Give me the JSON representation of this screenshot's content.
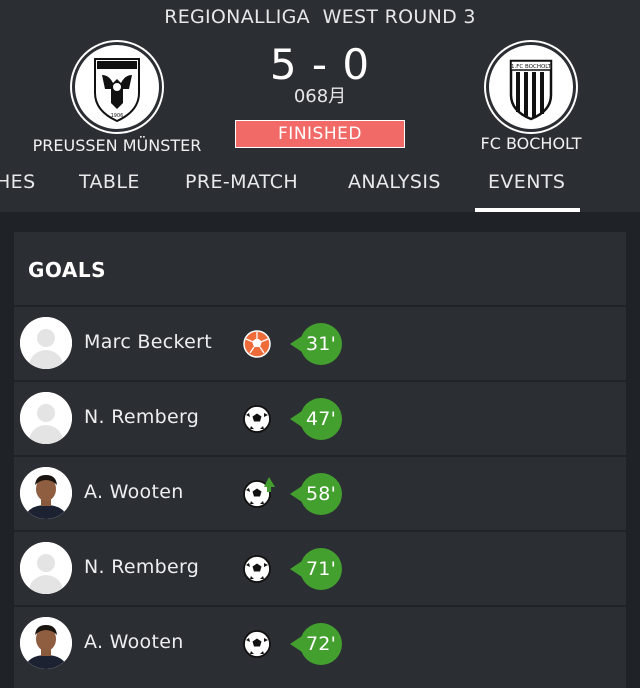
{
  "header": {
    "round_title": "REGIONALLIGA  WEST ROUND 3",
    "score": "5 - 0",
    "date": "068月",
    "status": "FINISHED",
    "home_team": {
      "name": "PREUSSEN MÜNSTER",
      "crest_icon": "preussen-munster-eagle-crest-icon"
    },
    "away_team": {
      "name": "FC BOCHOLT",
      "crest_icon": "fc-bocholt-shield-crest-icon"
    }
  },
  "tabs": [
    {
      "label": "HES",
      "active": false
    },
    {
      "label": "TABLE",
      "active": false
    },
    {
      "label": "PRE-MATCH",
      "active": false
    },
    {
      "label": "ANALYSIS",
      "active": false
    },
    {
      "label": "EVENTS",
      "active": true
    }
  ],
  "goals": {
    "title": "GOALS",
    "items": [
      {
        "player": "Marc Beckert",
        "minute": "31'",
        "goal_type": "own-goal",
        "icon": "own-goal-ball-icon",
        "avatar": "placeholder"
      },
      {
        "player": "N. Remberg",
        "minute": "47'",
        "goal_type": "goal",
        "icon": "soccer-ball-icon",
        "avatar": "placeholder"
      },
      {
        "player": "A. Wooten",
        "minute": "58'",
        "goal_type": "penalty-rebound",
        "icon": "soccer-ball-arrow-icon",
        "avatar": "photo"
      },
      {
        "player": "N. Remberg",
        "minute": "71'",
        "goal_type": "goal",
        "icon": "soccer-ball-icon",
        "avatar": "placeholder"
      },
      {
        "player": "A. Wooten",
        "minute": "72'",
        "goal_type": "goal",
        "icon": "soccer-ball-icon",
        "avatar": "photo"
      }
    ]
  },
  "colors": {
    "background": "#1f2227",
    "header": "#2b2e33",
    "card": "#2b2e33",
    "status_badge": "#f26a67",
    "minute_badge": "#43a02f",
    "own_goal": "#f06b3a"
  }
}
